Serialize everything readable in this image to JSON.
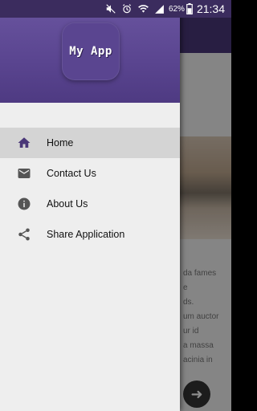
{
  "status_bar": {
    "icons": [
      "mute-icon",
      "alarm-icon",
      "wifi-icon",
      "signal-icon",
      "battery-icon"
    ],
    "battery_percent": "62%",
    "time": "21:34"
  },
  "drawer": {
    "logo_text": "My App",
    "items": [
      {
        "label": "Home",
        "icon": "home-icon",
        "selected": true
      },
      {
        "label": "Contact Us",
        "icon": "email-icon",
        "selected": false
      },
      {
        "label": "About Us",
        "icon": "info-icon",
        "selected": false
      },
      {
        "label": "Share Application",
        "icon": "share-icon",
        "selected": false
      }
    ]
  },
  "background_text": [
    "da fames",
    "e",
    "ds.",
    "um auctor",
    "ur id",
    "a massa",
    "acinia in"
  ],
  "colors": {
    "primary": "#5a4590",
    "status_bar": "#3b2c5e",
    "accent_icon": "#4a3778",
    "drawer_bg": "#eeeeee",
    "selected_bg": "#d4d4d4"
  }
}
